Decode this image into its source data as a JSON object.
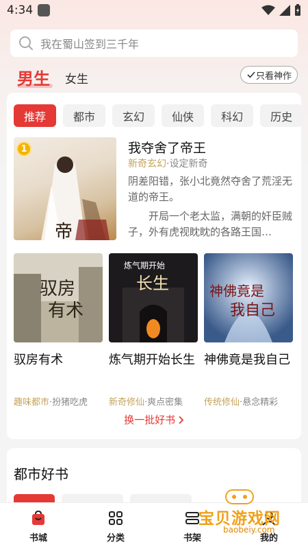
{
  "status_bar": {
    "time": "4:34"
  },
  "search": {
    "placeholder": "我在蜀山签到三千年"
  },
  "gender_tabs": {
    "male": "男生",
    "female": "女生",
    "god_only": "只看神作"
  },
  "categories": [
    "推荐",
    "都市",
    "玄幻",
    "仙侠",
    "科幻",
    "历史"
  ],
  "featured": {
    "rank": "1",
    "title": "我夺舍了帝王",
    "tag": "新奇玄幻",
    "tag_suffix": "·设定新奇",
    "desc1": "阴差阳错，张小北竟然夺舍了荒淫无道的帝王。",
    "desc2": "开局一个老太监，满朝的奸臣贼子，外有虎视眈眈的各路王国…"
  },
  "books": [
    {
      "title": "驭房有术",
      "tag": "趣味都市",
      "tag_suffix": "·扮猪吃虎"
    },
    {
      "title": "炼气期开始长生",
      "tag": "新奇修仙",
      "tag_suffix": "·爽点密集"
    },
    {
      "title": "神佛竟是我自己",
      "tag": "传统修仙",
      "tag_suffix": "·悬念精彩"
    }
  ],
  "refresh": "换一批好书",
  "city_section": {
    "title": "都市好书"
  },
  "bottom_nav": [
    {
      "label": "书城",
      "icon": "bag-icon"
    },
    {
      "label": "分类",
      "icon": "grid-icon"
    },
    {
      "label": "书架",
      "icon": "shelf-icon"
    },
    {
      "label": "我的",
      "icon": "user-icon"
    }
  ],
  "watermark": {
    "text": "宝贝游戏网",
    "url": "baobeiy.com"
  },
  "colors": {
    "accent": "#e53935",
    "tag": "#c6a35b"
  }
}
